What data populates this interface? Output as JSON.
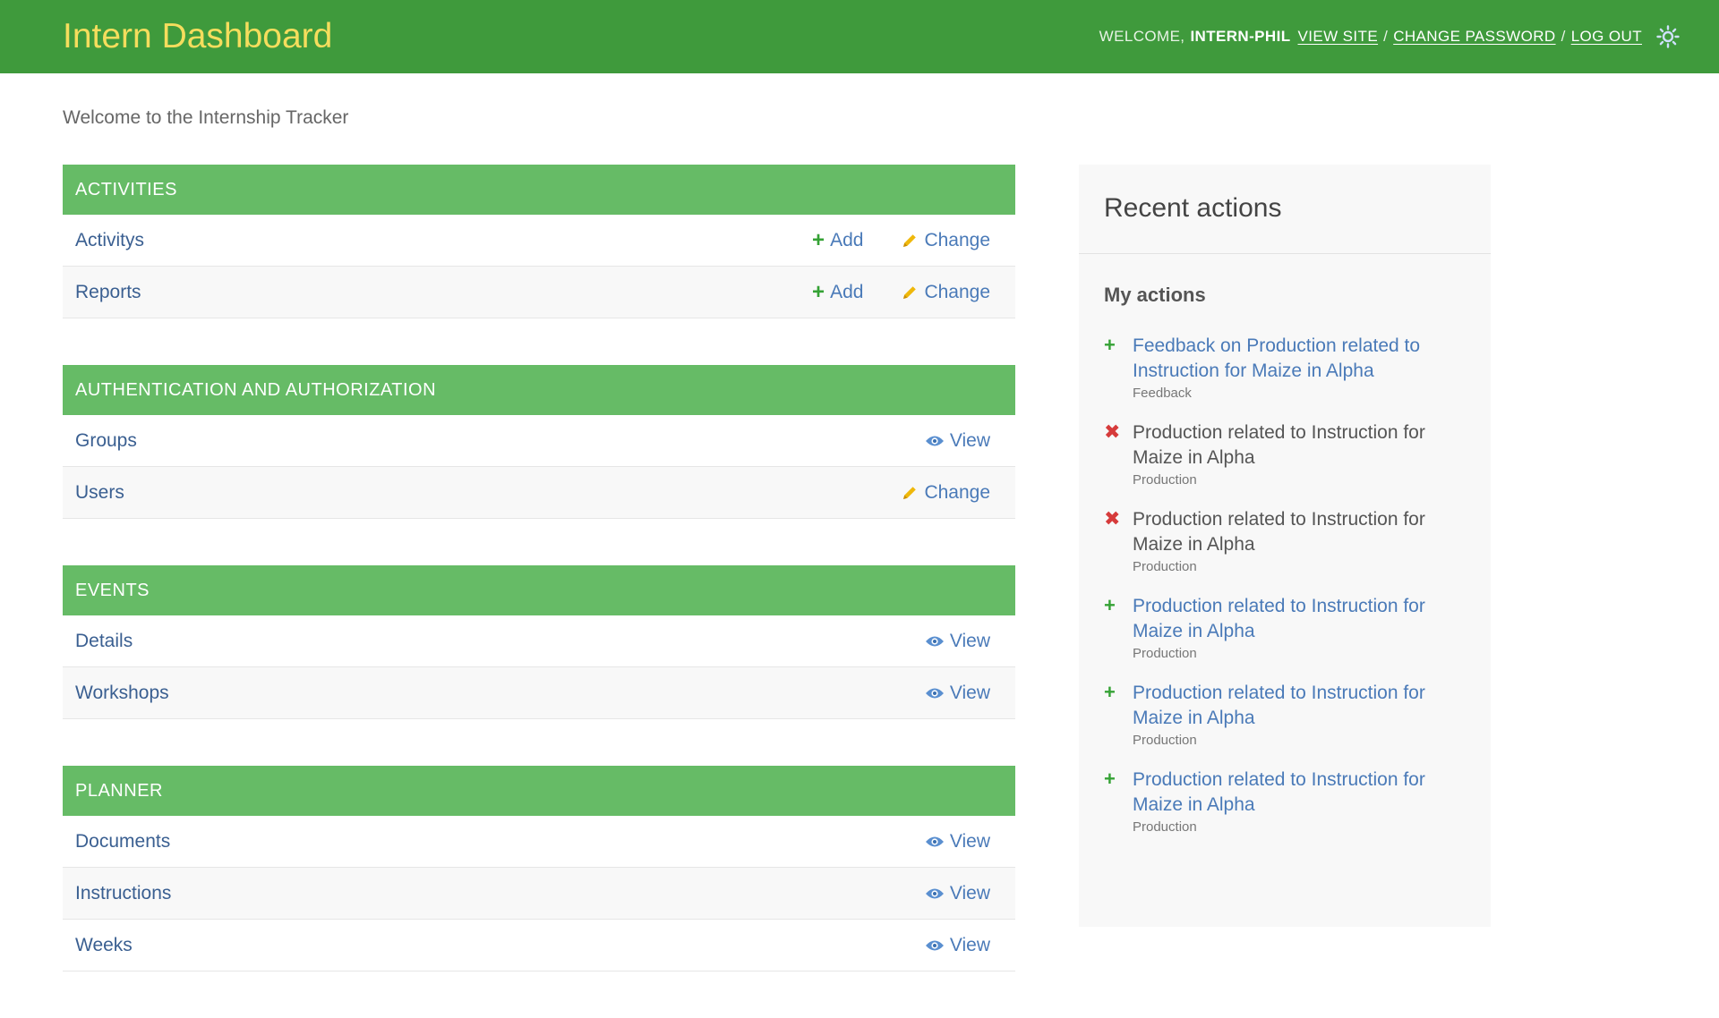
{
  "header": {
    "title": "Intern Dashboard",
    "welcome": "Welcome,",
    "username": "intern-phil",
    "view_site": "View site",
    "change_password": "Change password",
    "log_out": "Log out",
    "separator": "/",
    "theme_icon": "sun-icon"
  },
  "subtitle": "Welcome to the Internship Tracker",
  "labels": {
    "add": "Add",
    "change": "Change",
    "view": "View"
  },
  "modules": [
    {
      "caption": "Activities",
      "models": [
        {
          "name": "Activitys",
          "actions": [
            "add",
            "change"
          ]
        },
        {
          "name": "Reports",
          "actions": [
            "add",
            "change"
          ]
        }
      ]
    },
    {
      "caption": "Authentication and Authorization",
      "models": [
        {
          "name": "Groups",
          "actions": [
            "view"
          ]
        },
        {
          "name": "Users",
          "actions": [
            "change"
          ]
        }
      ]
    },
    {
      "caption": "Events",
      "models": [
        {
          "name": "Details",
          "actions": [
            "view"
          ]
        },
        {
          "name": "Workshops",
          "actions": [
            "view"
          ]
        }
      ]
    },
    {
      "caption": "Planner",
      "models": [
        {
          "name": "Documents",
          "actions": [
            "view"
          ]
        },
        {
          "name": "Instructions",
          "actions": [
            "view"
          ]
        },
        {
          "name": "Weeks",
          "actions": [
            "view"
          ]
        }
      ]
    }
  ],
  "recent_actions": {
    "title": "Recent actions",
    "subtitle": "My actions",
    "items": [
      {
        "kind": "add",
        "text": "Feedback on Production related to Instruction for Maize in Alpha",
        "type": "Feedback"
      },
      {
        "kind": "delete",
        "text": "Production related to Instruction for Maize in Alpha",
        "type": "Production"
      },
      {
        "kind": "delete",
        "text": "Production related to Instruction for Maize in Alpha",
        "type": "Production"
      },
      {
        "kind": "add",
        "text": "Production related to Instruction for Maize in Alpha",
        "type": "Production"
      },
      {
        "kind": "add",
        "text": "Production related to Instruction for Maize in Alpha",
        "type": "Production"
      },
      {
        "kind": "add",
        "text": "Production related to Instruction for Maize in Alpha",
        "type": "Production"
      }
    ]
  },
  "colors": {
    "header_bg": "#3f9a3c",
    "brand_text": "#f5dd5d",
    "module_caption_bg": "#66bb66",
    "link": "#4a7ab8",
    "add_icon": "#35a235",
    "delete_icon": "#d63b3b"
  }
}
